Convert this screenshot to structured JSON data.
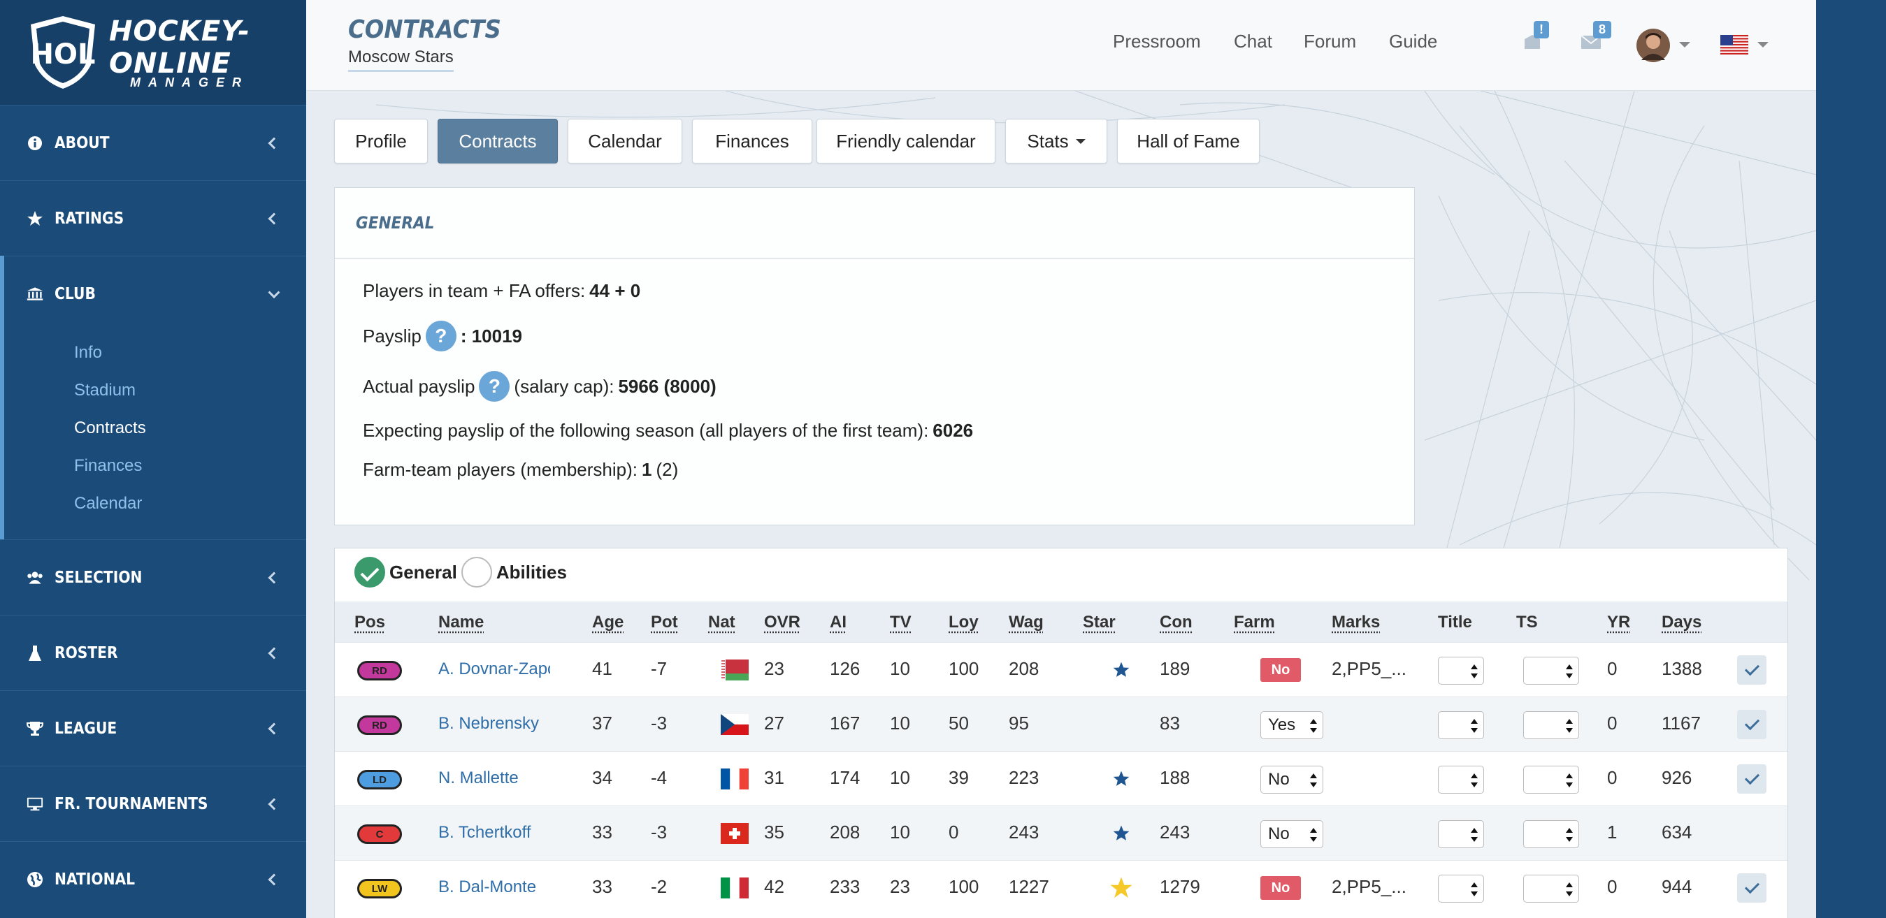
{
  "logo": {
    "line1": "HOCKEY-ONLINE",
    "line2": "MANAGER",
    "shield": "HOL"
  },
  "sidebar": {
    "items": [
      {
        "label": "ABOUT",
        "icon": "info-icon"
      },
      {
        "label": "RATINGS",
        "icon": "star-icon"
      },
      {
        "label": "CLUB",
        "icon": "bank-icon"
      },
      {
        "label": "SELECTION",
        "icon": "users-icon"
      },
      {
        "label": "ROSTER",
        "icon": "flask-icon"
      },
      {
        "label": "LEAGUE",
        "icon": "trophy-icon"
      },
      {
        "label": "FR. TOURNAMENTS",
        "icon": "monitor-icon"
      },
      {
        "label": "NATIONAL",
        "icon": "globe-icon"
      }
    ],
    "club_sub": [
      "Info",
      "Stadium",
      "Contracts",
      "Finances",
      "Calendar"
    ],
    "club_sub_active": "Contracts"
  },
  "header": {
    "title": "CONTRACTS",
    "team": "Moscow Stars",
    "nav": [
      "Pressroom",
      "Chat",
      "Forum",
      "Guide"
    ],
    "alert_badge": "!",
    "mail_badge": "8"
  },
  "tabs": [
    "Profile",
    "Contracts",
    "Calendar",
    "Finances",
    "Friendly calendar",
    "Stats",
    "Hall of Fame"
  ],
  "active_tab": "Contracts",
  "general": {
    "title": "GENERAL",
    "players_label": "Players in team + FA offers:",
    "players_value": "44 + 0",
    "payslip_label": "Payslip",
    "payslip_value": ": 10019",
    "actual_label": "Actual payslip",
    "actual_mid": "(salary cap):",
    "actual_value": "5966 (8000)",
    "expect_label": "Expecting payslip of the following season (all players of the first team):",
    "expect_value": "6026",
    "farm_label": "Farm-team players (membership):",
    "farm_value": "1",
    "farm_extra": "(2)"
  },
  "view_toggle": {
    "general": "General",
    "abilities": "Abilities"
  },
  "table": {
    "columns": [
      "Pos",
      "Name",
      "Age",
      "Pot",
      "Nat",
      "OVR",
      "AI",
      "TV",
      "Loy",
      "Wag",
      "Star",
      "Con",
      "Farm",
      "Marks",
      "Title",
      "TS",
      "YR",
      "Days"
    ],
    "rows": [
      {
        "pos": "RD",
        "pos_color": "#c2389c",
        "name": "A. Dovnar-Zapo",
        "age": "41",
        "pot": "-7",
        "nat": "BY",
        "ovr": "23",
        "ai": "126",
        "tv": "10",
        "loy": "100",
        "wag": "208",
        "star": "blue",
        "con": "189",
        "farm": "No-badge",
        "marks": "2,PP5_...",
        "yr": "0",
        "days": "1388",
        "check": true
      },
      {
        "pos": "RD",
        "pos_color": "#c2389c",
        "name": "B. Nebrensky",
        "age": "37",
        "pot": "-3",
        "nat": "CZ",
        "ovr": "27",
        "ai": "167",
        "tv": "10",
        "loy": "50",
        "wag": "95",
        "star": "",
        "con": "83",
        "farm": "Yes",
        "marks": "",
        "yr": "0",
        "days": "1167",
        "check": true
      },
      {
        "pos": "LD",
        "pos_color": "#4d9de0",
        "name": "N. Mallette",
        "age": "34",
        "pot": "-4",
        "nat": "FR",
        "ovr": "31",
        "ai": "174",
        "tv": "10",
        "loy": "39",
        "wag": "223",
        "star": "blue",
        "con": "188",
        "farm": "No",
        "marks": "",
        "yr": "0",
        "days": "926",
        "check": true
      },
      {
        "pos": "C",
        "pos_color": "#e23a3a",
        "name": "B. Tchertkoff",
        "age": "33",
        "pot": "-3",
        "nat": "CH",
        "ovr": "35",
        "ai": "208",
        "tv": "10",
        "loy": "0",
        "wag": "243",
        "star": "blue",
        "con": "243",
        "farm": "No",
        "marks": "",
        "yr": "1",
        "days": "634",
        "check": false
      },
      {
        "pos": "LW",
        "pos_color": "#f2c41e",
        "name": "B. Dal-Monte",
        "age": "33",
        "pot": "-2",
        "nat": "IT",
        "ovr": "42",
        "ai": "233",
        "tv": "23",
        "loy": "100",
        "wag": "1227",
        "star": "gold",
        "con": "1279",
        "farm": "No-badge",
        "marks": "2,PP5_...",
        "yr": "0",
        "days": "944",
        "check": true
      }
    ]
  }
}
